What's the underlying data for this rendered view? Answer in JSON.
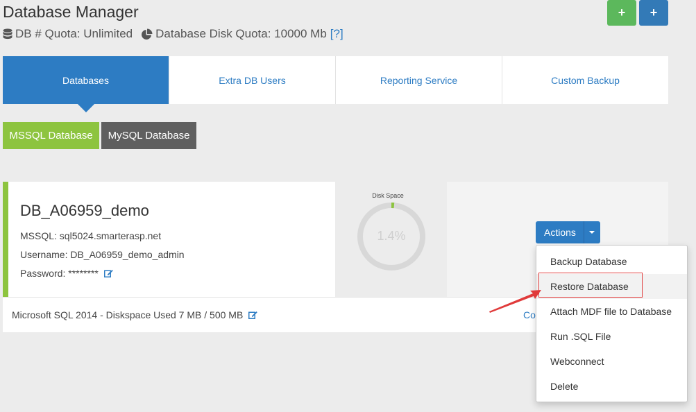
{
  "header": {
    "title": "Database Manager",
    "db_quota": "DB # Quota: Unlimited",
    "disk_quota": "Database Disk Quota: 10000 Mb",
    "help": "[?]",
    "add_label_1": "+",
    "add_label_2": "+"
  },
  "tabs": [
    {
      "label": "Databases",
      "active": true
    },
    {
      "label": "Extra DB Users"
    },
    {
      "label": "Reporting Service"
    },
    {
      "label": "Custom Backup"
    }
  ],
  "subtabs": [
    {
      "label": "MSSQL Database",
      "active": true
    },
    {
      "label": "MySQL Database"
    }
  ],
  "database": {
    "name": "DB_A06959_demo",
    "server": "MSSQL: sql5024.smarterasp.net",
    "username": "Username: DB_A06959_demo_admin",
    "password": "Password: ********",
    "disk_label": "Disk Space",
    "disk_percent": "1.4%",
    "disk_fraction": 0.014,
    "footer": "Microsoft SQL 2014 - Diskspace Used 7 MB / 500 MB",
    "footer_link": "Co"
  },
  "actions": {
    "label": "Actions",
    "items": [
      {
        "label": "Backup Database"
      },
      {
        "label": "Restore Database",
        "highlighted": true
      },
      {
        "label": "Attach MDF file to Database"
      },
      {
        "label": "Run .SQL File"
      },
      {
        "label": "Webconnect"
      },
      {
        "label": "Delete"
      }
    ]
  },
  "colors": {
    "primary": "#2d7cc3",
    "green": "#8dc43f",
    "success": "#5cb85c",
    "dark": "#5f5f5f",
    "annotation": "#e03a3a"
  }
}
